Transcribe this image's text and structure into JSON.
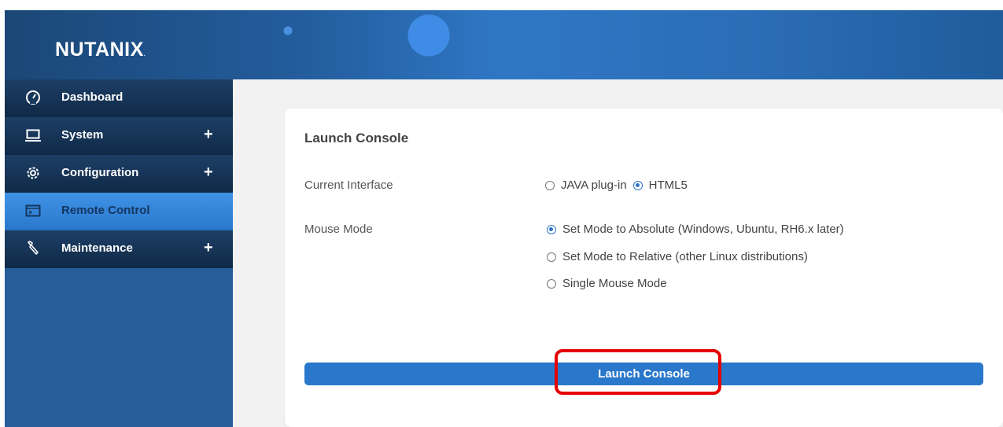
{
  "brand": {
    "logo_text": "NUTANIX",
    "logo_mark": "."
  },
  "sidebar": {
    "items": [
      {
        "label": "Dashboard",
        "icon": "dashboard-gauge-icon",
        "expandable": false,
        "active": false
      },
      {
        "label": "System",
        "icon": "laptop-icon",
        "expandable": true,
        "plus": "+",
        "active": false
      },
      {
        "label": "Configuration",
        "icon": "gear-icon",
        "expandable": true,
        "plus": "+",
        "active": false
      },
      {
        "label": "Remote Control",
        "icon": "terminal-icon",
        "expandable": false,
        "active": true
      },
      {
        "label": "Maintenance",
        "icon": "wrench-icon",
        "expandable": true,
        "plus": "+",
        "active": false
      }
    ]
  },
  "panel": {
    "title": "Launch Console",
    "current_interface": {
      "label": "Current Interface",
      "options": [
        {
          "label": "JAVA plug-in",
          "checked": false
        },
        {
          "label": "HTML5",
          "checked": true
        }
      ]
    },
    "mouse_mode": {
      "label": "Mouse Mode",
      "options": [
        {
          "label": "Set Mode to Absolute (Windows, Ubuntu, RH6.x later)",
          "checked": true
        },
        {
          "label": "Set Mode to Relative (other Linux distributions)",
          "checked": false
        },
        {
          "label": "Single Mouse Mode",
          "checked": false
        }
      ]
    },
    "launch_button_label": "Launch Console"
  },
  "colors": {
    "sidebar_dark": "#102a48",
    "sidebar_active": "#3a8ce0",
    "accent_blue": "#2a78cb",
    "highlight_red": "#e60000"
  }
}
